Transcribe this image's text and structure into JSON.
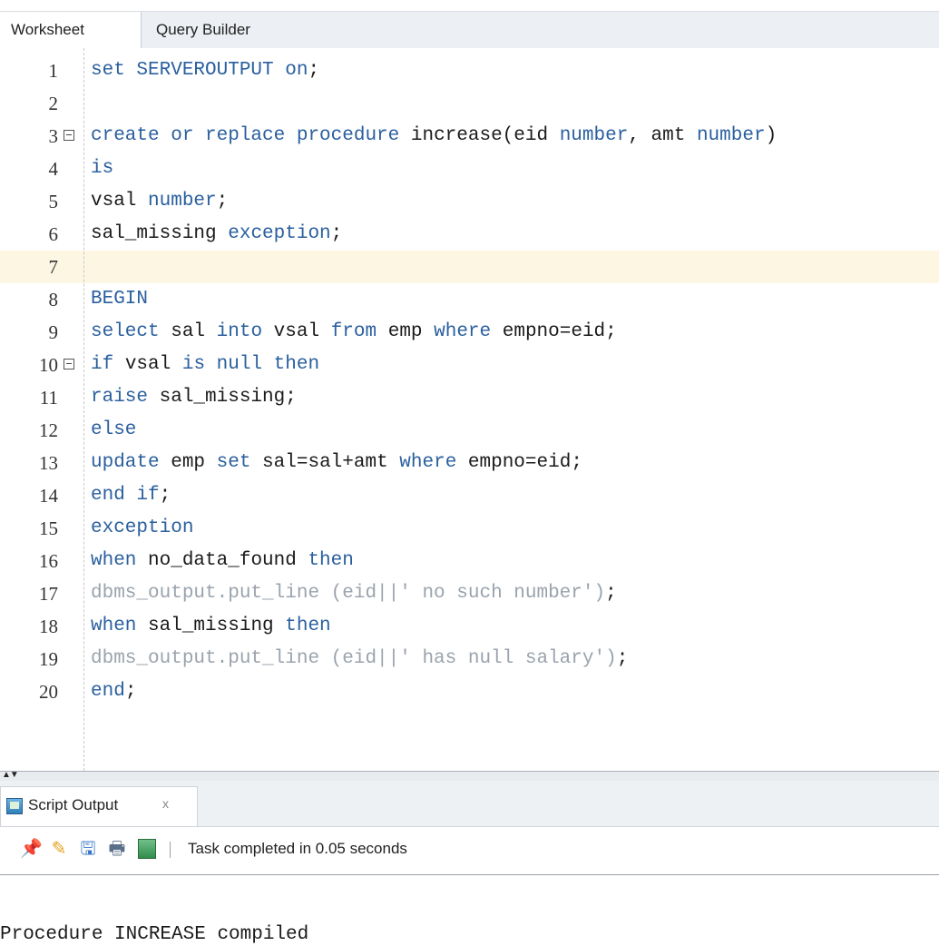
{
  "tabs": {
    "worksheet": "Worksheet",
    "query_builder": "Query Builder"
  },
  "editor": {
    "current_line": 7,
    "lines": [
      {
        "n": "1",
        "fold": false,
        "tokens": [
          {
            "t": "set SERVEROUTPUT on",
            "c": "kw"
          },
          {
            "t": ";",
            "c": ""
          }
        ]
      },
      {
        "n": "2",
        "fold": false,
        "tokens": []
      },
      {
        "n": "3",
        "fold": true,
        "tokens": [
          {
            "t": "create or replace procedure",
            "c": "kw"
          },
          {
            "t": " increase(eid ",
            "c": ""
          },
          {
            "t": "number",
            "c": "kw"
          },
          {
            "t": ", amt ",
            "c": ""
          },
          {
            "t": "number",
            "c": "kw"
          },
          {
            "t": ")",
            "c": ""
          }
        ]
      },
      {
        "n": "4",
        "fold": false,
        "tokens": [
          {
            "t": "is",
            "c": "kw"
          }
        ]
      },
      {
        "n": "5",
        "fold": false,
        "tokens": [
          {
            "t": "vsal ",
            "c": ""
          },
          {
            "t": "number",
            "c": "kw"
          },
          {
            "t": ";",
            "c": ""
          }
        ]
      },
      {
        "n": "6",
        "fold": false,
        "tokens": [
          {
            "t": "sal_missing ",
            "c": ""
          },
          {
            "t": "exception",
            "c": "kw"
          },
          {
            "t": ";",
            "c": ""
          }
        ]
      },
      {
        "n": "7",
        "fold": false,
        "tokens": []
      },
      {
        "n": "8",
        "fold": false,
        "tokens": [
          {
            "t": "BEGIN",
            "c": "kw"
          }
        ]
      },
      {
        "n": "9",
        "fold": false,
        "tokens": [
          {
            "t": "select",
            "c": "kw"
          },
          {
            "t": " sal ",
            "c": ""
          },
          {
            "t": "into",
            "c": "kw"
          },
          {
            "t": " vsal ",
            "c": ""
          },
          {
            "t": "from",
            "c": "kw"
          },
          {
            "t": " emp ",
            "c": ""
          },
          {
            "t": "where",
            "c": "kw"
          },
          {
            "t": " empno=eid;",
            "c": ""
          }
        ]
      },
      {
        "n": "10",
        "fold": true,
        "tokens": [
          {
            "t": "if",
            "c": "kw"
          },
          {
            "t": " vsal ",
            "c": ""
          },
          {
            "t": "is null then",
            "c": "kw"
          }
        ]
      },
      {
        "n": "11",
        "fold": false,
        "tokens": [
          {
            "t": "raise",
            "c": "kw"
          },
          {
            "t": " sal_missing;",
            "c": ""
          }
        ]
      },
      {
        "n": "12",
        "fold": false,
        "tokens": [
          {
            "t": "else",
            "c": "kw"
          }
        ]
      },
      {
        "n": "13",
        "fold": false,
        "tokens": [
          {
            "t": "update",
            "c": "kw"
          },
          {
            "t": " emp ",
            "c": ""
          },
          {
            "t": "set",
            "c": "kw"
          },
          {
            "t": " sal=sal+amt ",
            "c": ""
          },
          {
            "t": "where",
            "c": "kw"
          },
          {
            "t": " empno=eid;",
            "c": ""
          }
        ]
      },
      {
        "n": "14",
        "fold": false,
        "tokens": [
          {
            "t": "end if",
            "c": "kw"
          },
          {
            "t": ";",
            "c": ""
          }
        ]
      },
      {
        "n": "15",
        "fold": false,
        "tokens": [
          {
            "t": "exception",
            "c": "kw"
          }
        ]
      },
      {
        "n": "16",
        "fold": false,
        "tokens": [
          {
            "t": "when",
            "c": "kw"
          },
          {
            "t": " no_data_found ",
            "c": ""
          },
          {
            "t": "then",
            "c": "kw"
          }
        ]
      },
      {
        "n": "17",
        "fold": false,
        "tokens": [
          {
            "t": "dbms_output.put_line (eid||' no such number')",
            "c": "fn"
          },
          {
            "t": ";",
            "c": ""
          }
        ]
      },
      {
        "n": "18",
        "fold": false,
        "tokens": [
          {
            "t": "when",
            "c": "kw"
          },
          {
            "t": " sal_missing ",
            "c": ""
          },
          {
            "t": "then",
            "c": "kw"
          }
        ]
      },
      {
        "n": "19",
        "fold": false,
        "tokens": [
          {
            "t": "dbms_output.put_line (eid||' has null salary')",
            "c": "fn"
          },
          {
            "t": ";",
            "c": ""
          }
        ]
      },
      {
        "n": "20",
        "fold": false,
        "tokens": [
          {
            "t": "end",
            "c": "kw"
          },
          {
            "t": ";",
            "c": ""
          }
        ]
      }
    ]
  },
  "output": {
    "tab_label": "Script Output",
    "close_label": "x",
    "status": "Task completed in 0.05 seconds",
    "console": "Procedure INCREASE compiled",
    "icons": [
      "pin-icon",
      "eraser-icon",
      "save-icon",
      "print-icon",
      "script-icon"
    ]
  }
}
